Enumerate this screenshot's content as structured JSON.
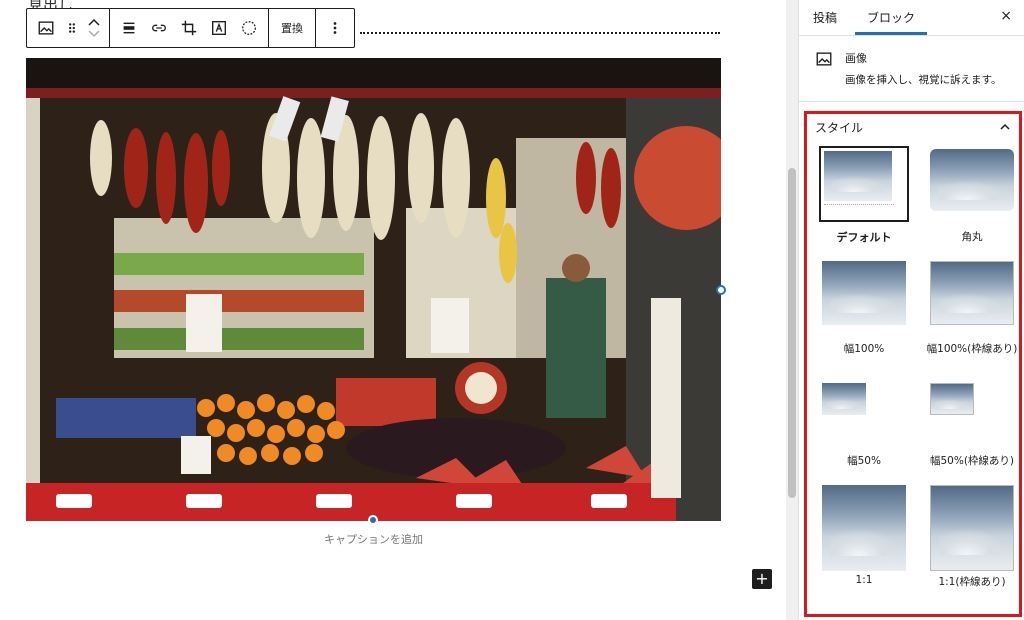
{
  "editor": {
    "heading_peek": "見出し",
    "caption_placeholder": "キャプションを追加",
    "inserter_label": "+"
  },
  "toolbar": {
    "replace_label": "置換",
    "icons": [
      "image-icon",
      "drag-handle-icon",
      "move-up-down-icon",
      "align-icon",
      "link-icon",
      "crop-icon",
      "text-overlay-icon",
      "circle-mask-icon",
      "more-options-icon"
    ]
  },
  "sidebar": {
    "tabs": [
      {
        "label": "投稿",
        "active": false
      },
      {
        "label": "ブロック",
        "active": true
      }
    ],
    "close_label": "×",
    "block_card": {
      "title": "画像",
      "description": "画像を挿入し、視覚に訴えます。"
    },
    "styles": {
      "title": "スタイル",
      "items": [
        {
          "label": "デフォルト",
          "selected": true
        },
        {
          "label": "角丸",
          "selected": false
        },
        {
          "label": "幅100%",
          "selected": false
        },
        {
          "label": "幅100%(枠線あり)",
          "selected": false
        },
        {
          "label": "幅50%",
          "selected": false
        },
        {
          "label": "幅50%(枠線あり)",
          "selected": false
        },
        {
          "label": "1:1",
          "selected": false
        },
        {
          "label": "1:1(枠線あり)",
          "selected": false
        }
      ]
    }
  },
  "colors": {
    "accent": "#2271b1",
    "highlight_border": "#d7191e",
    "text": "#1e1e1e"
  }
}
